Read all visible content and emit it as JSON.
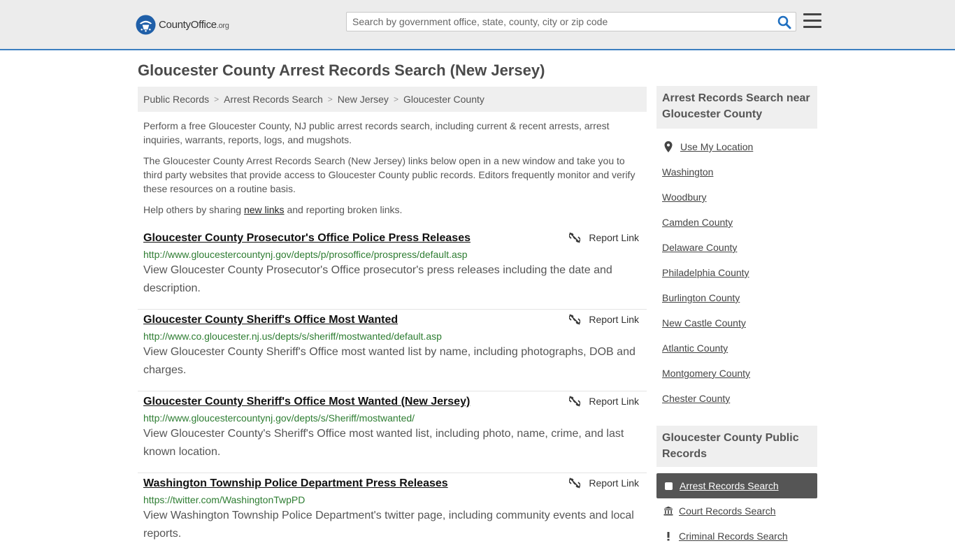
{
  "header": {
    "logo_main": "CountyOffice",
    "logo_tld": ".org",
    "search_placeholder": "Search by government office, state, county, city or zip code",
    "search_value": ""
  },
  "page_title": "Gloucester County Arrest Records Search (New Jersey)",
  "breadcrumb": [
    "Public Records",
    "Arrest Records Search",
    "New Jersey",
    "Gloucester County"
  ],
  "intro": {
    "p1": "Perform a free Gloucester County, NJ public arrest records search, including current & recent arrests, arrest inquiries, warrants, reports, logs, and mugshots.",
    "p2": "The Gloucester County Arrest Records Search (New Jersey) links below open in a new window and take you to third party websites that provide access to Gloucester County public records. Editors frequently monitor and verify these resources on a routine basis.",
    "p3_before": "Help others by sharing ",
    "p3_link": "new links",
    "p3_after": " and reporting broken links."
  },
  "report_label": "Report Link",
  "results": [
    {
      "title": "Gloucester County Prosecutor's Office Police Press Releases",
      "url": "http://www.gloucestercountynj.gov/depts/p/prosoffice/prospress/default.asp",
      "desc": "View Gloucester County Prosecutor's Office prosecutor's press releases including the date and description."
    },
    {
      "title": "Gloucester County Sheriff's Office Most Wanted",
      "url": "http://www.co.gloucester.nj.us/depts/s/sheriff/mostwanted/default.asp",
      "desc": "View Gloucester County Sheriff's Office most wanted list by name, including photographs, DOB and charges."
    },
    {
      "title": "Gloucester County Sheriff's Office Most Wanted (New Jersey)",
      "url": "http://www.gloucestercountynj.gov/depts/s/Sheriff/mostwanted/",
      "desc": "View Gloucester County's Sheriff's Office most wanted list, including photo, name, crime, and last known location."
    },
    {
      "title": "Washington Township Police Department Press Releases",
      "url": "https://twitter.com/WashingtonTwpPD",
      "desc": "View Washington Township Police Department's twitter page, including community events and local reports."
    }
  ],
  "sidebar": {
    "nearby_heading": "Arrest Records Search near Gloucester County",
    "use_location": "Use My Location",
    "nearby": [
      "Washington",
      "Woodbury",
      "Camden County",
      "Delaware County",
      "Philadelphia County",
      "Burlington County",
      "New Castle County",
      "Atlantic County",
      "Montgomery County",
      "Chester County"
    ],
    "public_heading": "Gloucester County Public Records",
    "public_items": [
      "Arrest Records Search",
      "Court Records Search",
      "Criminal Records Search"
    ]
  },
  "colors": {
    "header_bg": "#ececec",
    "header_border": "#3b7ec0",
    "url_green": "#2e7d32",
    "search_icon_blue": "#1f6fc0",
    "active_item_bg": "#555555"
  }
}
